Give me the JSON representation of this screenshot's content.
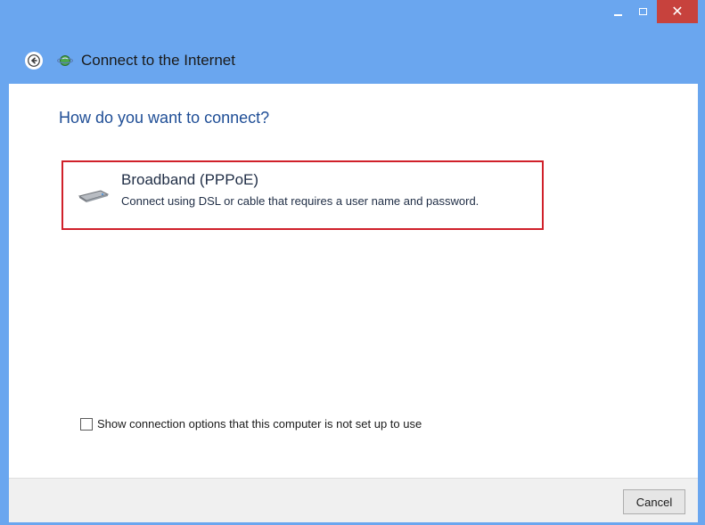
{
  "window": {
    "title": "Connect to the Internet",
    "controls": {
      "minimize": "minimize",
      "maximize": "maximize",
      "close_glyph": "✕"
    }
  },
  "main": {
    "question": "How do you want to connect?",
    "option": {
      "title": "Broadband (PPPoE)",
      "description": "Connect using DSL or cable that requires a user name and password.",
      "icon": "broadband-modem-icon",
      "highlight_color": "#d0202a"
    },
    "show_options": {
      "label": "Show connection options that this computer is not set up to use",
      "checked": false
    }
  },
  "footer": {
    "cancel_label": "Cancel"
  },
  "colors": {
    "titlebar": "#6aa6ef",
    "close_button": "#c7423d",
    "question_text": "#1f4e96"
  }
}
